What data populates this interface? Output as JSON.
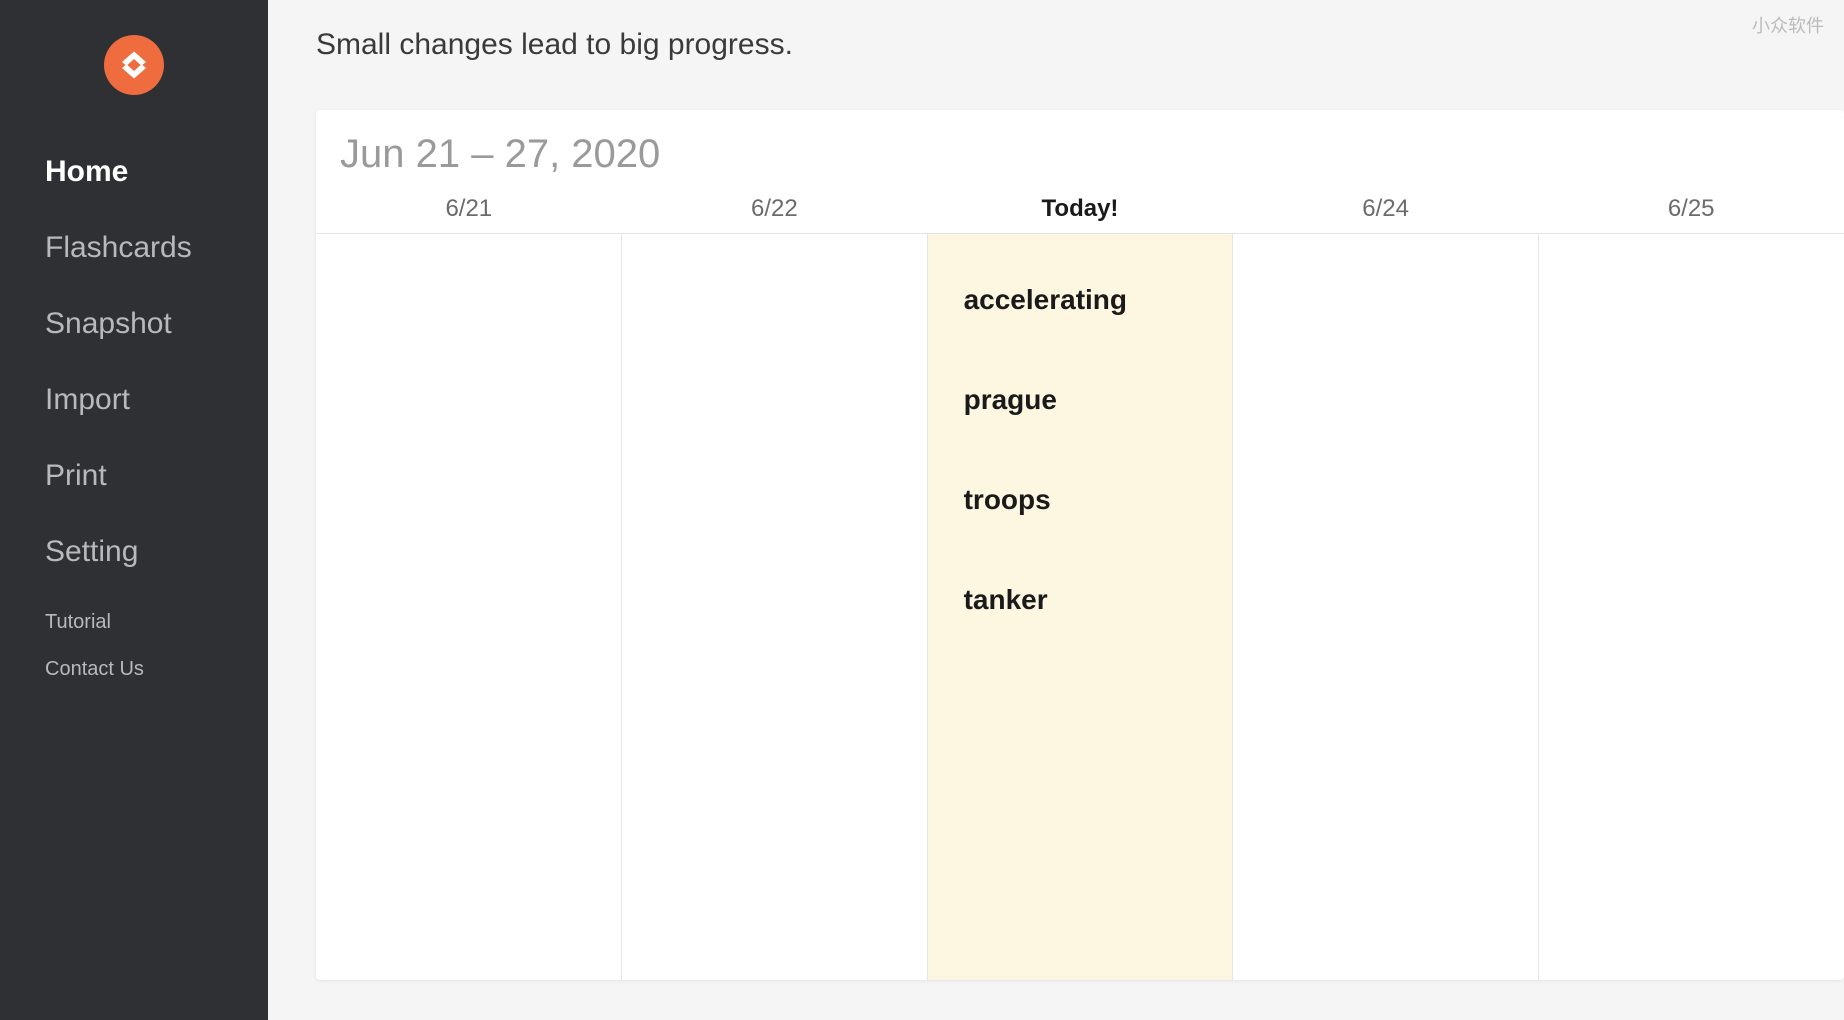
{
  "watermark": "小众软件",
  "tagline": "Small changes lead to big progress.",
  "sidebar": {
    "items": [
      {
        "label": "Home",
        "active": true
      },
      {
        "label": "Flashcards",
        "active": false
      },
      {
        "label": "Snapshot",
        "active": false
      },
      {
        "label": "Import",
        "active": false
      },
      {
        "label": "Print",
        "active": false
      },
      {
        "label": "Setting",
        "active": false
      }
    ],
    "footer_items": [
      {
        "label": "Tutorial"
      },
      {
        "label": "Contact Us"
      }
    ]
  },
  "calendar": {
    "date_range": "Jun 21 – 27, 2020",
    "days": [
      {
        "label": "6/21",
        "today": false
      },
      {
        "label": "6/22",
        "today": false
      },
      {
        "label": "Today!",
        "today": true
      },
      {
        "label": "6/24",
        "today": false
      },
      {
        "label": "6/25",
        "today": false
      }
    ],
    "today_words": [
      "accelerating",
      "prague",
      "troops",
      "tanker"
    ]
  }
}
